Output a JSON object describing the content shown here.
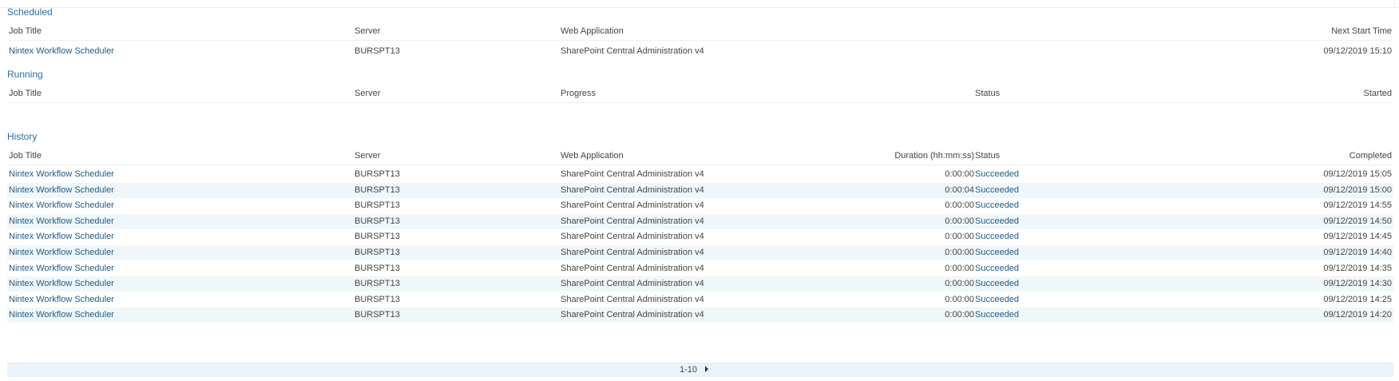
{
  "sections": {
    "scheduled": {
      "title": "Scheduled",
      "columns": [
        "Job Title",
        "Server",
        "Web Application",
        "Next Start Time"
      ],
      "rows": [
        {
          "job": "Nintex Workflow Scheduler",
          "server": "BURSPT13",
          "webapp": "SharePoint Central Administration v4",
          "next_start": "09/12/2019 15:10"
        }
      ]
    },
    "running": {
      "title": "Running",
      "columns": [
        "Job Title",
        "Server",
        "Progress",
        "Status",
        "Started"
      ]
    },
    "history": {
      "title": "History",
      "columns": [
        "Job Title",
        "Server",
        "Web Application",
        "Duration (hh:mm:ss)",
        "Status",
        "Completed"
      ],
      "rows": [
        {
          "job": "Nintex Workflow Scheduler",
          "server": "BURSPT13",
          "webapp": "SharePoint Central Administration v4",
          "duration": "0:00:00",
          "status": "Succeeded",
          "completed": "09/12/2019 15:05"
        },
        {
          "job": "Nintex Workflow Scheduler",
          "server": "BURSPT13",
          "webapp": "SharePoint Central Administration v4",
          "duration": "0:00:04",
          "status": "Succeeded",
          "completed": "09/12/2019 15:00"
        },
        {
          "job": "Nintex Workflow Scheduler",
          "server": "BURSPT13",
          "webapp": "SharePoint Central Administration v4",
          "duration": "0:00:00",
          "status": "Succeeded",
          "completed": "09/12/2019 14:55"
        },
        {
          "job": "Nintex Workflow Scheduler",
          "server": "BURSPT13",
          "webapp": "SharePoint Central Administration v4",
          "duration": "0:00:00",
          "status": "Succeeded",
          "completed": "09/12/2019 14:50"
        },
        {
          "job": "Nintex Workflow Scheduler",
          "server": "BURSPT13",
          "webapp": "SharePoint Central Administration v4",
          "duration": "0:00:00",
          "status": "Succeeded",
          "completed": "09/12/2019 14:45"
        },
        {
          "job": "Nintex Workflow Scheduler",
          "server": "BURSPT13",
          "webapp": "SharePoint Central Administration v4",
          "duration": "0:00:00",
          "status": "Succeeded",
          "completed": "09/12/2019 14:40"
        },
        {
          "job": "Nintex Workflow Scheduler",
          "server": "BURSPT13",
          "webapp": "SharePoint Central Administration v4",
          "duration": "0:00:00",
          "status": "Succeeded",
          "completed": "09/12/2019 14:35"
        },
        {
          "job": "Nintex Workflow Scheduler",
          "server": "BURSPT13",
          "webapp": "SharePoint Central Administration v4",
          "duration": "0:00:00",
          "status": "Succeeded",
          "completed": "09/12/2019 14:30"
        },
        {
          "job": "Nintex Workflow Scheduler",
          "server": "BURSPT13",
          "webapp": "SharePoint Central Administration v4",
          "duration": "0:00:00",
          "status": "Succeeded",
          "completed": "09/12/2019 14:25"
        },
        {
          "job": "Nintex Workflow Scheduler",
          "server": "BURSPT13",
          "webapp": "SharePoint Central Administration v4",
          "duration": "0:00:00",
          "status": "Succeeded",
          "completed": "09/12/2019 14:20"
        }
      ]
    }
  },
  "pager": {
    "range": "1-10",
    "next_icon": "next-page-arrow-icon"
  },
  "colors": {
    "link": "#1f5b86",
    "section_title": "#2a6fa3",
    "alt_row": "#f0f7fb",
    "pager_bg": "#eaf3fa"
  }
}
